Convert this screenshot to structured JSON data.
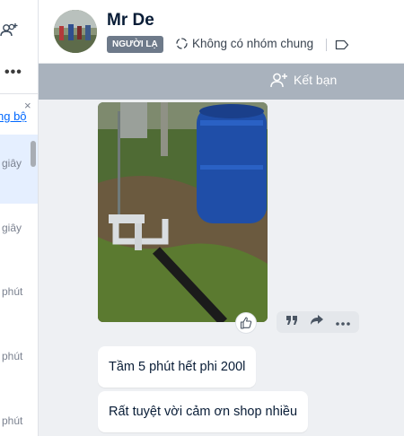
{
  "sidebar": {
    "top_icon": "group-add-icon",
    "more_label": "•••",
    "link_text": "ng bộ",
    "close_label": "×",
    "times": [
      "giây",
      "giây",
      "phút",
      "phút",
      "phút"
    ]
  },
  "header": {
    "name": "Mr De",
    "badge": "NGƯỜI LẠ",
    "group_info": "Không có nhóm chung",
    "tag_icon": "label-icon"
  },
  "friend_bar": {
    "button_label": "Kết bạn",
    "icon": "user-add-icon"
  },
  "chat": {
    "photo_icon": "photo-message",
    "reaction_icon": "thumbs-up-icon",
    "actions": [
      "quote-icon",
      "share-icon",
      "more-icon"
    ],
    "messages": [
      "Tầm 5 phút hết phi 200l",
      "Rất tuyệt vời cảm ơn shop nhiều"
    ]
  },
  "colors": {
    "accent": "#0068ff",
    "friend_bar": "#a9b2bd",
    "chat_bg": "#eef0f3",
    "badge": "#6e7a8a"
  }
}
